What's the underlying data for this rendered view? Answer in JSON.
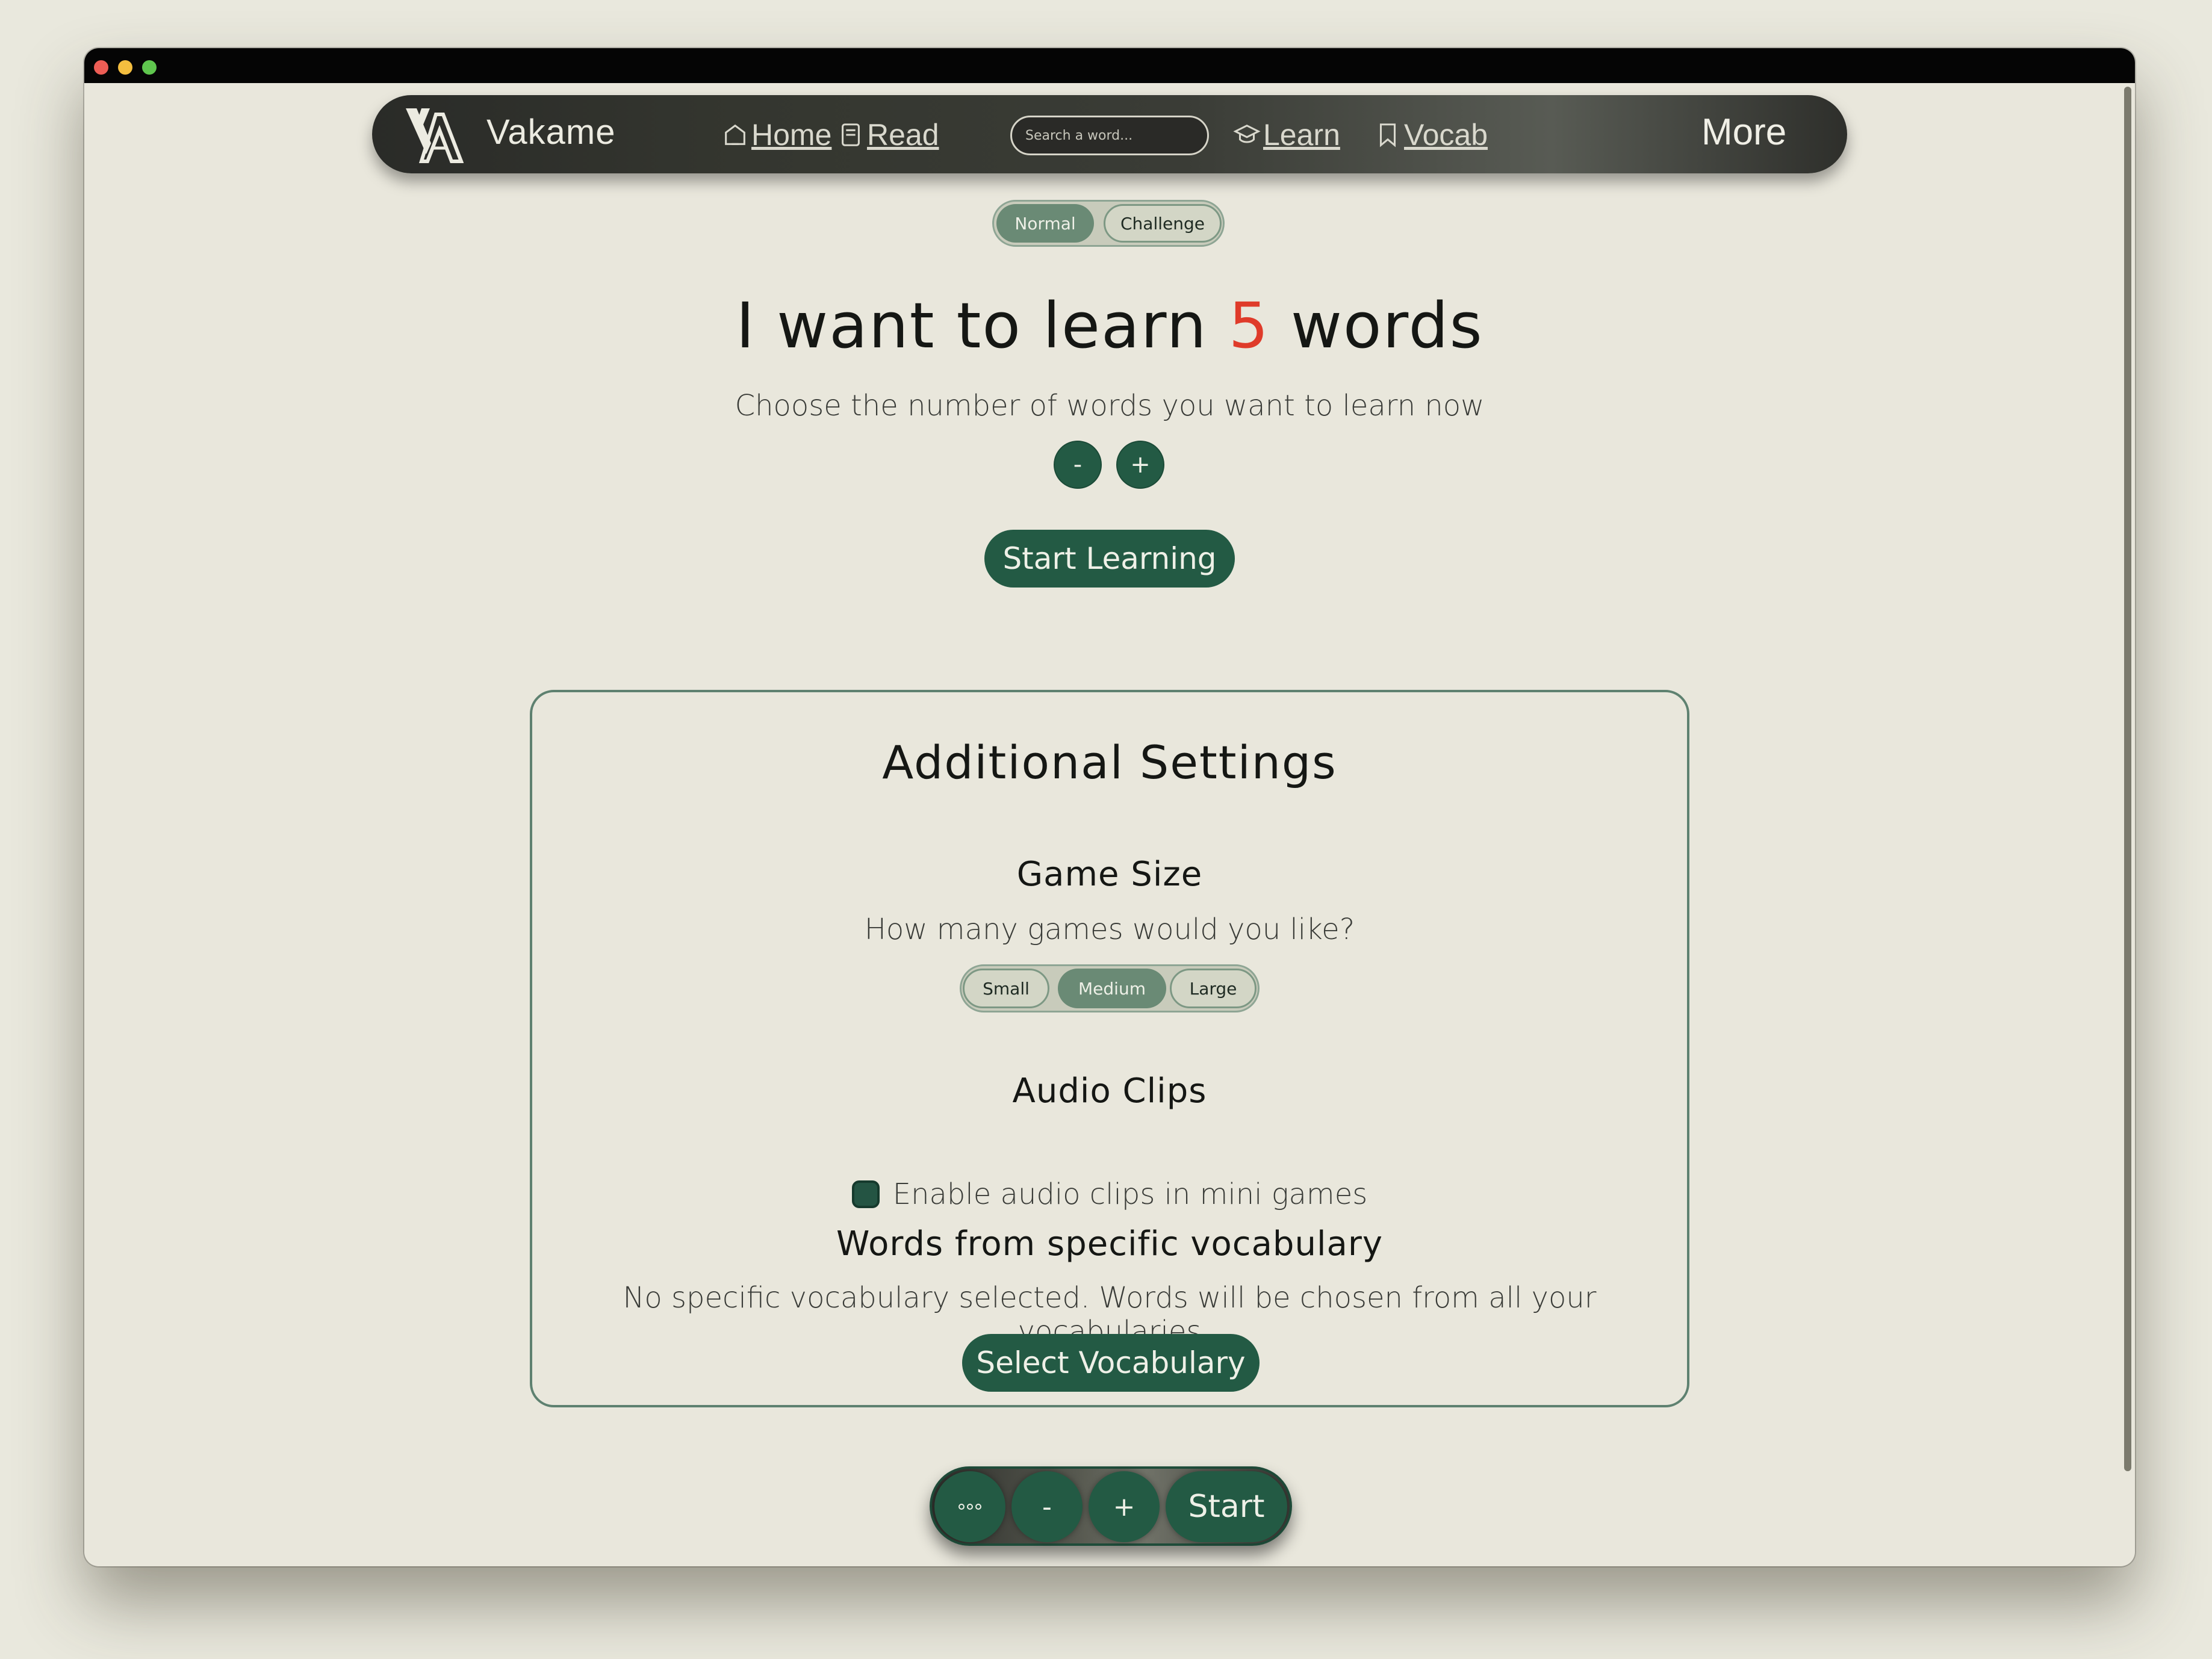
{
  "nav": {
    "brand": "Vakame",
    "links": [
      {
        "label": "Home",
        "icon": "home-icon"
      },
      {
        "label": "Read",
        "icon": "book-icon"
      },
      {
        "label": "Learn",
        "icon": "graduation-cap-icon"
      },
      {
        "label": "Vocab",
        "icon": "bookmark-icon"
      }
    ],
    "search_placeholder": "Search a word...",
    "more_label": "More"
  },
  "mode": {
    "options": [
      "Normal",
      "Challenge"
    ],
    "selected": "Normal"
  },
  "learn": {
    "heading_prefix": "I want to learn ",
    "word_count": "5",
    "heading_suffix": " words",
    "subtitle": "Choose the number of words you want to learn now",
    "minus_label": "-",
    "plus_label": "+",
    "start_label": "Start Learning"
  },
  "settings": {
    "title": "Additional Settings",
    "game_size": {
      "title": "Game Size",
      "description": "How many games would you like?",
      "options": [
        "Small",
        "Medium",
        "Large"
      ],
      "selected": "Medium"
    },
    "audio": {
      "title": "Audio Clips",
      "checkbox_label": "Enable audio clips in mini games",
      "checked": true
    },
    "vocabulary": {
      "title": "Words from specific vocabulary",
      "description": "No specific vocabulary selected. Words will be chosen from all your vocabularies",
      "button_label": "Select Vocabulary"
    }
  },
  "bottom_bar": {
    "more_icon": "three-dots-icon",
    "minus_label": "-",
    "plus_label": "+",
    "start_label": "Start"
  },
  "colors": {
    "accent": "#235a44",
    "highlight_number": "#df3b2a",
    "background": "#e9e7dc"
  }
}
